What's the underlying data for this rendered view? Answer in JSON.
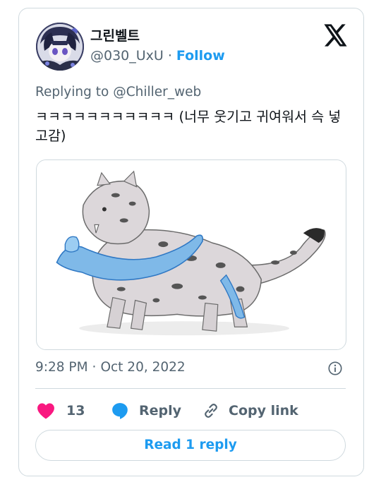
{
  "author": {
    "display_name": "그린벨트",
    "handle": "@030_UxU",
    "separator": "·",
    "follow_label": "Follow"
  },
  "tweet": {
    "replying_prefix": "Replying to",
    "replying_to": "@Chiller_web",
    "text": "ㅋㅋㅋㅋㅋㅋㅋㅋㅋㅋㅋ (너무 웃기고 귀여워서 슥 넣고감)",
    "time": "9:28 PM",
    "separator": "·",
    "date": "Oct 20, 2022"
  },
  "actions": {
    "like_count": "13",
    "reply_label": "Reply",
    "copy_label": "Copy link",
    "read_replies_label": "Read 1 reply"
  },
  "colors": {
    "accent": "#1d9bf0",
    "like": "#f91880",
    "muted": "#536471",
    "border": "#cfd9de"
  },
  "icons": [
    "x-logo-icon",
    "heart-icon",
    "reply-bubble-icon",
    "link-icon",
    "info-icon"
  ]
}
